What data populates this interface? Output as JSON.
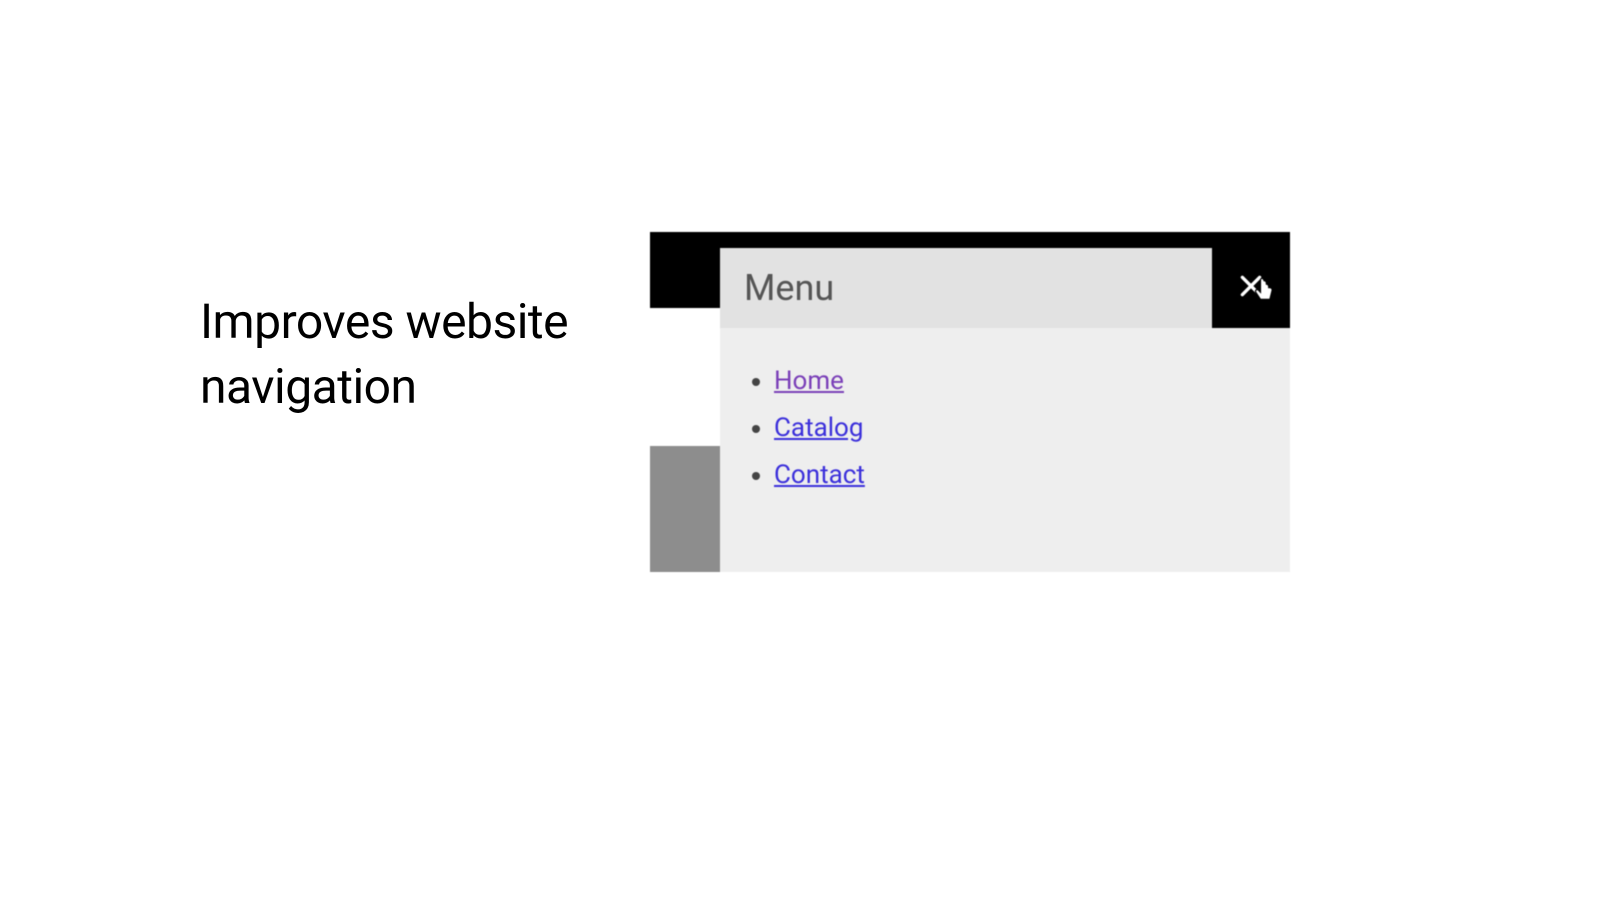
{
  "heading": "Improves website\nnavigation",
  "menu": {
    "title": "Menu",
    "items": [
      {
        "label": "Home",
        "visited": true
      },
      {
        "label": "Catalog",
        "visited": false
      },
      {
        "label": "Contact",
        "visited": false
      }
    ]
  }
}
